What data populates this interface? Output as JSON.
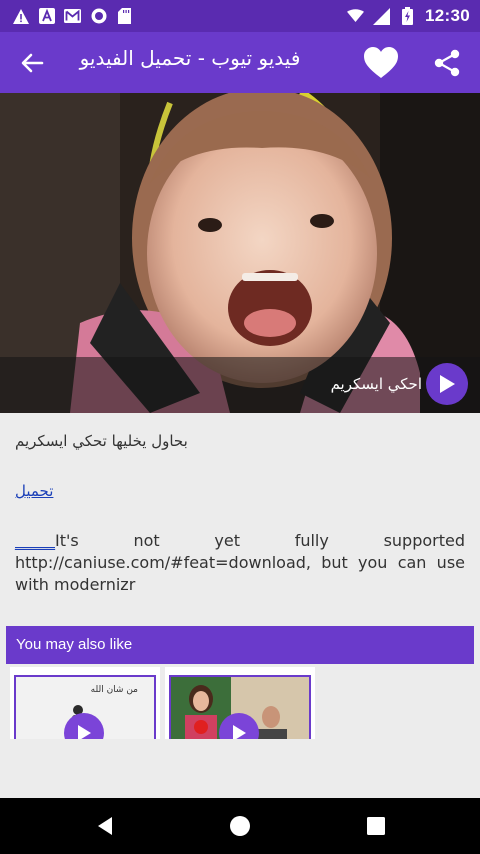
{
  "status_bar": {
    "time": "12:30",
    "icons": [
      "warning-icon",
      "a-icon",
      "mail-icon",
      "record-icon",
      "sd-card-icon",
      "wifi-icon",
      "signal-icon",
      "battery-icon"
    ]
  },
  "app_bar": {
    "title": "فيديو تيوب - تحميل الفيديو"
  },
  "video": {
    "caption": "احكي ايسكريم"
  },
  "content": {
    "description": "بحاول يخليها تحكي ايسكريم",
    "download_link": "تحميل",
    "body_link": "_____",
    "body_text": "It's not yet fully supported http://caniuse.com/#feat=download, but you can use with modernizr"
  },
  "related": {
    "header": "You may also like",
    "item1_text": "من شان الله"
  },
  "colors": {
    "status_bar": "#5a2bb0",
    "app_bar": "#6a3acb",
    "accent": "#6a3acb",
    "link": "#1a3fb8",
    "background": "#ececec"
  }
}
